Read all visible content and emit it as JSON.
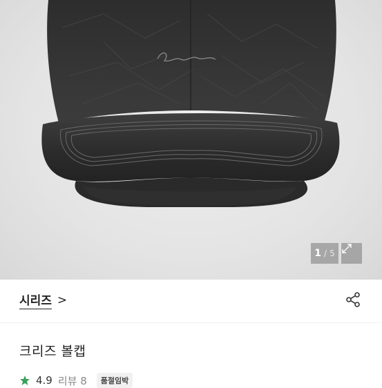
{
  "gallery": {
    "current": "1",
    "separator": "/",
    "total": "5",
    "expand_icon": "expand-icon"
  },
  "product": {
    "series_label": "시리즈",
    "series_chevron": ">",
    "share_icon": "share-icon",
    "title": "크리즈 볼캡",
    "rating": "4.9",
    "reviews_label": "리뷰 8",
    "badge": "품절임박"
  },
  "colors": {
    "star": "#3aa15a",
    "pager_bg": "#7a7a7a"
  }
}
